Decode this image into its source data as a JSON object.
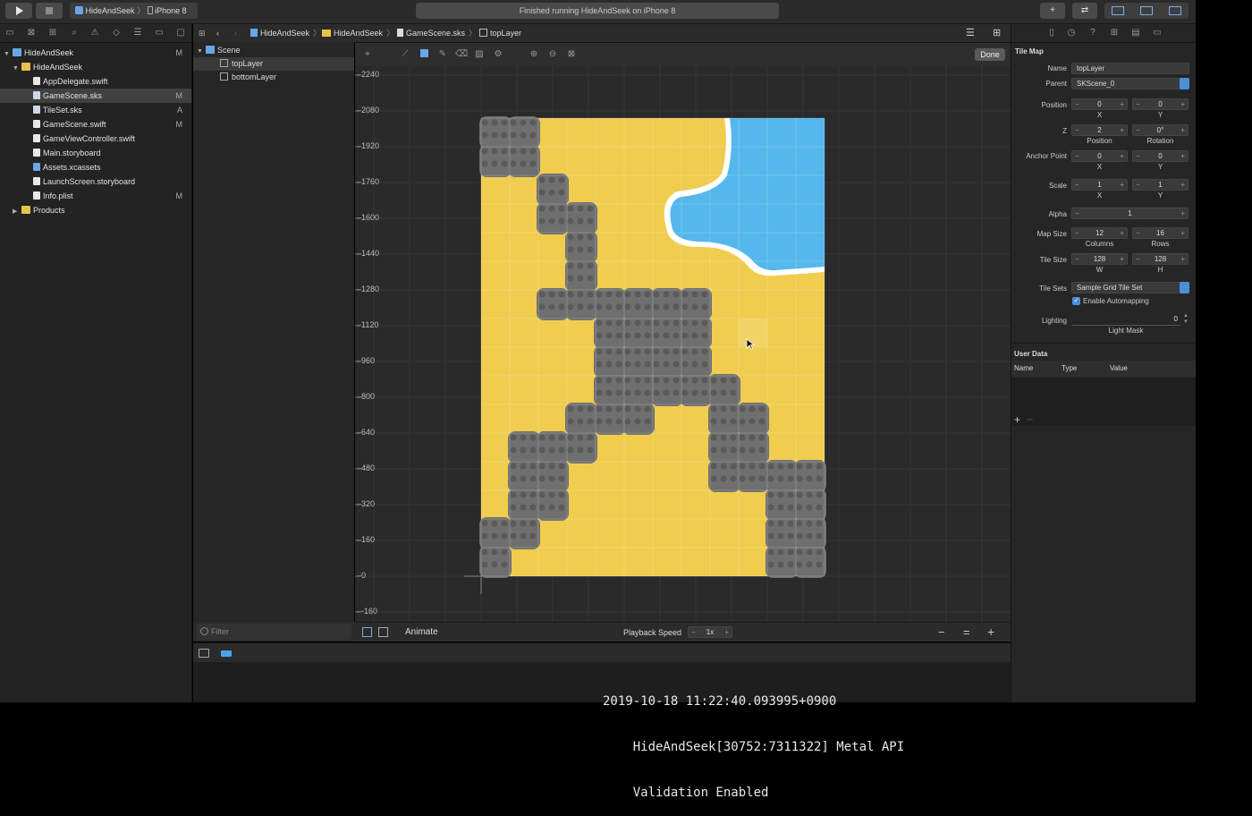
{
  "toolbar": {
    "scheme_target": "HideAndSeek",
    "scheme_device": "iPhone 8",
    "status": "Finished running HideAndSeek on iPhone 8",
    "add_label": "+",
    "swap_label": "⇄"
  },
  "navigator": {
    "project": {
      "name": "HideAndSeek",
      "badge": "M"
    },
    "group": "HideAndSeek",
    "files": [
      {
        "name": "AppDelegate.swift",
        "badge": ""
      },
      {
        "name": "GameScene.sks",
        "badge": "M"
      },
      {
        "name": "TileSet.sks",
        "badge": "A"
      },
      {
        "name": "GameScene.swift",
        "badge": "M"
      },
      {
        "name": "GameViewController.swift",
        "badge": ""
      },
      {
        "name": "Main.storyboard",
        "badge": ""
      },
      {
        "name": "Assets.xcassets",
        "badge": ""
      },
      {
        "name": "LaunchScreen.storyboard",
        "badge": ""
      },
      {
        "name": "Info.plist",
        "badge": "M"
      }
    ],
    "products": "Products"
  },
  "jumpbar": {
    "crumbs": [
      "HideAndSeek",
      "HideAndSeek",
      "GameScene.sks",
      "topLayer"
    ]
  },
  "outline": {
    "root": "Scene",
    "items": [
      "topLayer",
      "bottomLayer"
    ],
    "filter_placeholder": "Filter"
  },
  "editor": {
    "done_label": "Done",
    "y_ticks": [
      "2240",
      "2080",
      "1920",
      "1760",
      "1600",
      "1440",
      "1280",
      "1120",
      "960",
      "800",
      "640",
      "480",
      "320",
      "160",
      "0",
      "-160"
    ],
    "animate_label": "Animate",
    "playback_label": "Playback Speed",
    "playback_value": "1x",
    "zoom_minus": "−",
    "zoom_equal": "=",
    "zoom_plus": "+"
  },
  "console": {
    "lines": [
      "2019-10-18 11:22:40.093995+0900",
      "    HideAndSeek[30752:7311322] Metal API",
      "    Validation Enabled"
    ]
  },
  "inspector": {
    "title": "Tile Map",
    "name_label": "Name",
    "name_value": "topLayer",
    "parent_label": "Parent",
    "parent_value": "SKScene_0",
    "position_label": "Position",
    "position_x": "0",
    "position_y": "0",
    "x_label": "X",
    "y_label": "Y",
    "z_label": "Z",
    "z_value": "2",
    "rotation_value": "0°",
    "position_sub": "Position",
    "rotation_sub": "Rotation",
    "anchor_label": "Anchor Point",
    "anchor_x": "0",
    "anchor_y": "0",
    "scale_label": "Scale",
    "scale_x": "1",
    "scale_y": "1",
    "alpha_label": "Alpha",
    "alpha_value": "1",
    "mapsize_label": "Map Size",
    "columns": "12",
    "rows": "16",
    "columns_label": "Columns",
    "rows_label": "Rows",
    "tilesize_label": "Tile Size",
    "tile_w": "128",
    "tile_h": "128",
    "w_label": "W",
    "h_label": "H",
    "tilesets_label": "Tile Sets",
    "tilesets_value": "Sample Grid Tile Set",
    "automapping_label": "Enable Automapping",
    "automapping": true,
    "lighting_label": "Lighting",
    "lighting_value": "0",
    "lightmask_label": "Light Mask",
    "userdata_title": "User Data",
    "userdata_columns": [
      "Name",
      "Type",
      "Value"
    ],
    "add_label": "+",
    "remove_label": "−"
  },
  "colors": {
    "sand": "#f0cc4f",
    "stone": "#6f6f6f",
    "water": "#55b8ec",
    "foam": "#ffffff",
    "selection": "#414141"
  }
}
